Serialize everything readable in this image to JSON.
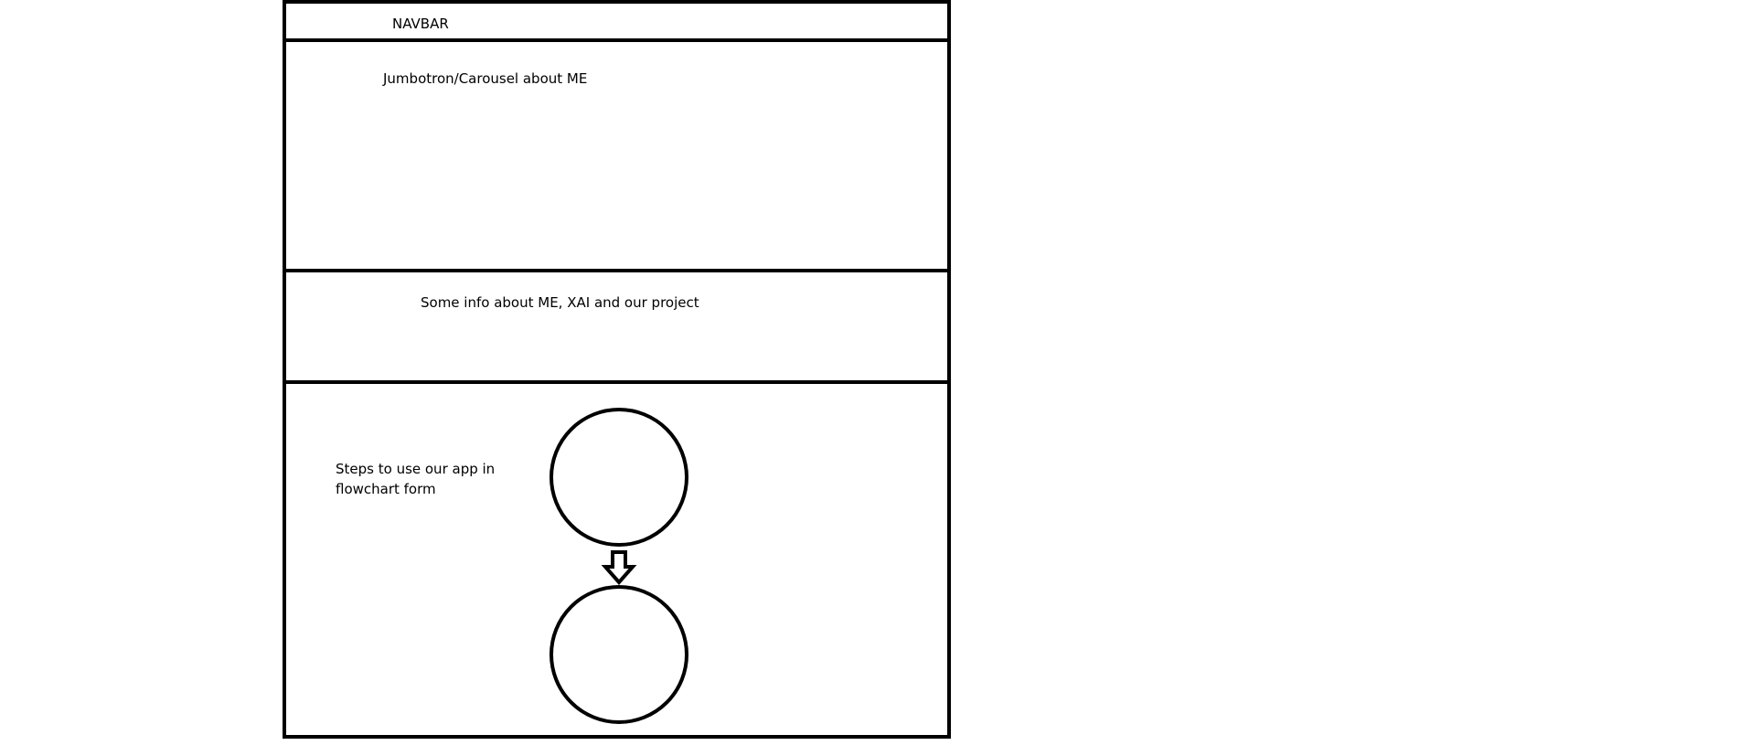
{
  "sections": {
    "navbar": {
      "label": "NAVBAR"
    },
    "jumbotron": {
      "label": "Jumbotron/Carousel about ME"
    },
    "info": {
      "label": "Some info about ME, XAI and our project"
    },
    "steps": {
      "label": "Steps to use our app in flowchart form"
    }
  },
  "colors": {
    "stroke": "#000000",
    "background": "#ffffff"
  }
}
